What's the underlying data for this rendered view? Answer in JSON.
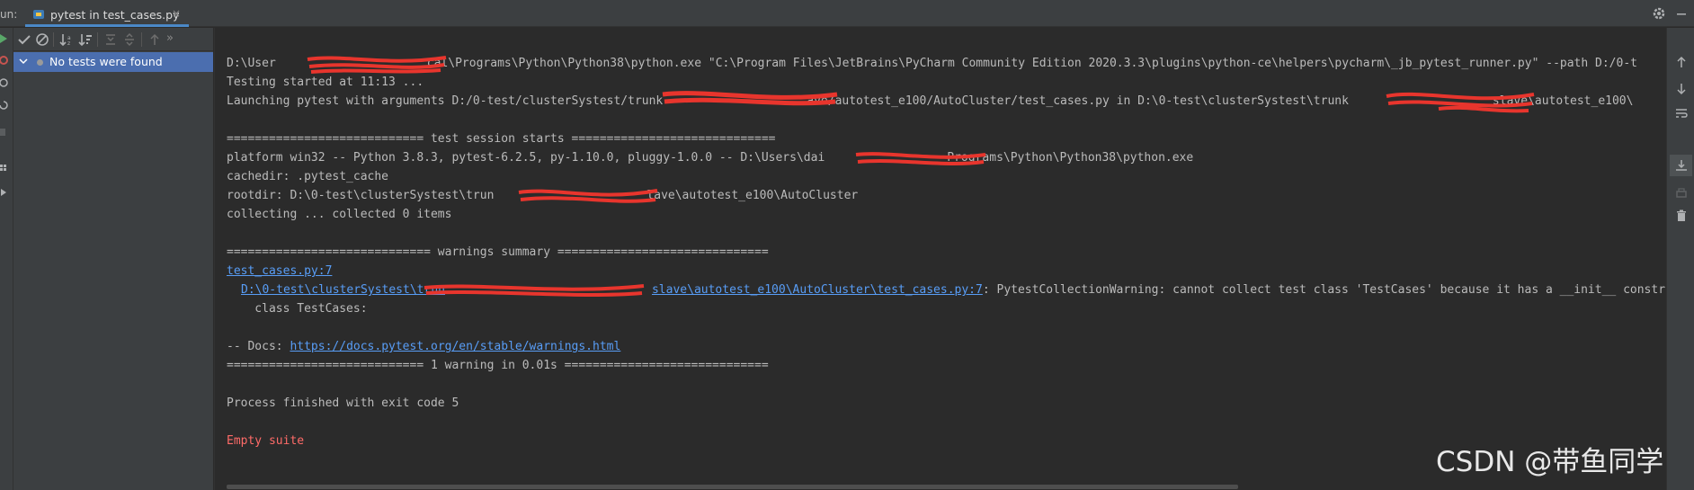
{
  "header": {
    "run_label": "un:",
    "tab_label": "pytest in test_cases.py",
    "tab_close": "×",
    "settings_icon": "gear-icon",
    "minimize_icon": "minimize-icon"
  },
  "tree": {
    "toolbar_icons": [
      "check-icon",
      "stop-icon",
      "sort-alpha-icon",
      "sort-duration-icon",
      "expand-all-icon",
      "collapse-all-icon",
      "up-arrow-icon",
      "more-icon"
    ],
    "more_label": "»",
    "items": [
      {
        "label": "No tests were found"
      }
    ]
  },
  "console": {
    "lines": {
      "l1_a": "D:\\User",
      "l1_b": "cal\\Programs\\Python\\Python38\\python.exe \"C:\\Program Files\\JetBrains\\PyCharm Community Edition 2020.3.3\\plugins\\python-ce\\helpers\\pycharm\\_jb_pytest_runner.py\" --path D:/0-t",
      "l2": "Testing started at 11:13 ...",
      "l3_a": "Launching pytest with arguments D:/0-test/clusterSystest/trunk",
      "l3_b": "ave/autotest_e100/AutoCluster/test_cases.py in D:\\0-test\\clusterSystest\\trunk",
      "l3_c": "slave\\autotest_e100\\",
      "l5": "============================ test session starts =============================",
      "l6_a": "platform win32 -- Python 3.8.3, pytest-6.2.5, py-1.10.0, pluggy-1.0.0 -- D:\\Users\\dai",
      "l6_b": "Programs\\Python\\Python38\\python.exe",
      "l7": "cachedir: .pytest_cache",
      "l8_a": "rootdir: D:\\0-test\\clusterSystest\\trun",
      "l8_b": "lave\\autotest_e100\\AutoCluster",
      "l9": "collecting ... collected 0 items",
      "l11": "============================= warnings summary ==============================",
      "l12": "test_cases.py:7",
      "l13_link_a": "D:\\0-test\\clusterSystest\\trun",
      "l13_link_b": "slave\\autotest_e100\\AutoCluster\\test_cases.py:7",
      "l13_rest": ": PytestCollectionWarning: cannot collect test class 'TestCases' because it has a __init__ constructor",
      "l14": "    class TestCases:",
      "l16_a": "-- Docs: ",
      "l16_link": "https://docs.pytest.org/en/stable/warnings.html",
      "l17": "============================ 1 warning in 0.01s =============================",
      "l19": "Process finished with exit code 5",
      "l21": "Empty suite"
    }
  },
  "right_toolbar": {
    "icons": [
      "arrow-up-icon",
      "arrow-down-icon",
      "soft-wrap-icon",
      "scroll-to-end-icon",
      "print-icon",
      "trash-icon"
    ]
  },
  "watermark": "CSDN @带鱼同学",
  "colors": {
    "accent": "#4a88c7",
    "selection": "#4b6eaf",
    "link": "#589df6",
    "error": "#ff6b68",
    "run_green": "#59a869"
  }
}
